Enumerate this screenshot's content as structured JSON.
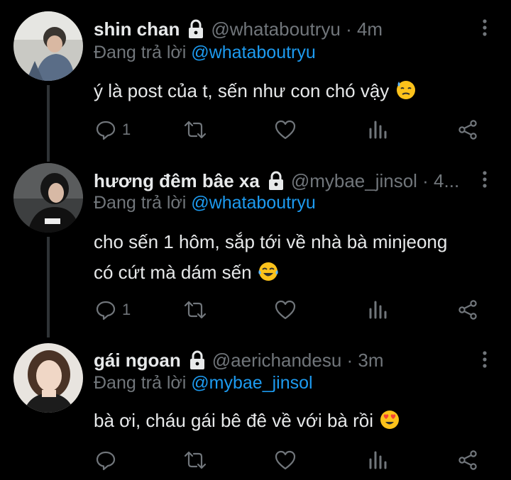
{
  "tweets": [
    {
      "display_name": "shin chan",
      "handle_meta": "@whataboutryu · 4m",
      "reply_prefix": "Đang trả lời",
      "reply_to": "@whataboutryu",
      "text": "ý là post của t, sến như con chó vậy",
      "emoji": "😓",
      "reply_count": "1"
    },
    {
      "display_name": "hương đêm bâe xa",
      "handle_meta": "@mybae_jinsol · 4...",
      "reply_prefix": "Đang trả lời",
      "reply_to": "@whataboutryu",
      "text_line1": "cho sến 1 hôm, sắp tới về nhà bà minjeong",
      "text_line2": "có cứt mà dám sến",
      "emoji": "😂",
      "reply_count": "1"
    },
    {
      "display_name": "gái ngoan",
      "handle_meta": "@aerichandesu · 3m",
      "reply_prefix": "Đang trả lời",
      "reply_to": "@mybae_jinsol",
      "text": "bà ơi, cháu gái bê đê về với bà rồi",
      "emoji": "😍",
      "reply_count": ""
    }
  ],
  "icons": [
    "lock-icon",
    "more-icon",
    "reply-icon",
    "retweet-icon",
    "like-icon",
    "analytics-icon",
    "share-icon"
  ],
  "colors": {
    "background": "#000000",
    "text": "#e7e9ea",
    "muted": "#71767b",
    "link": "#1d9bf0",
    "thread": "#2f3336"
  }
}
